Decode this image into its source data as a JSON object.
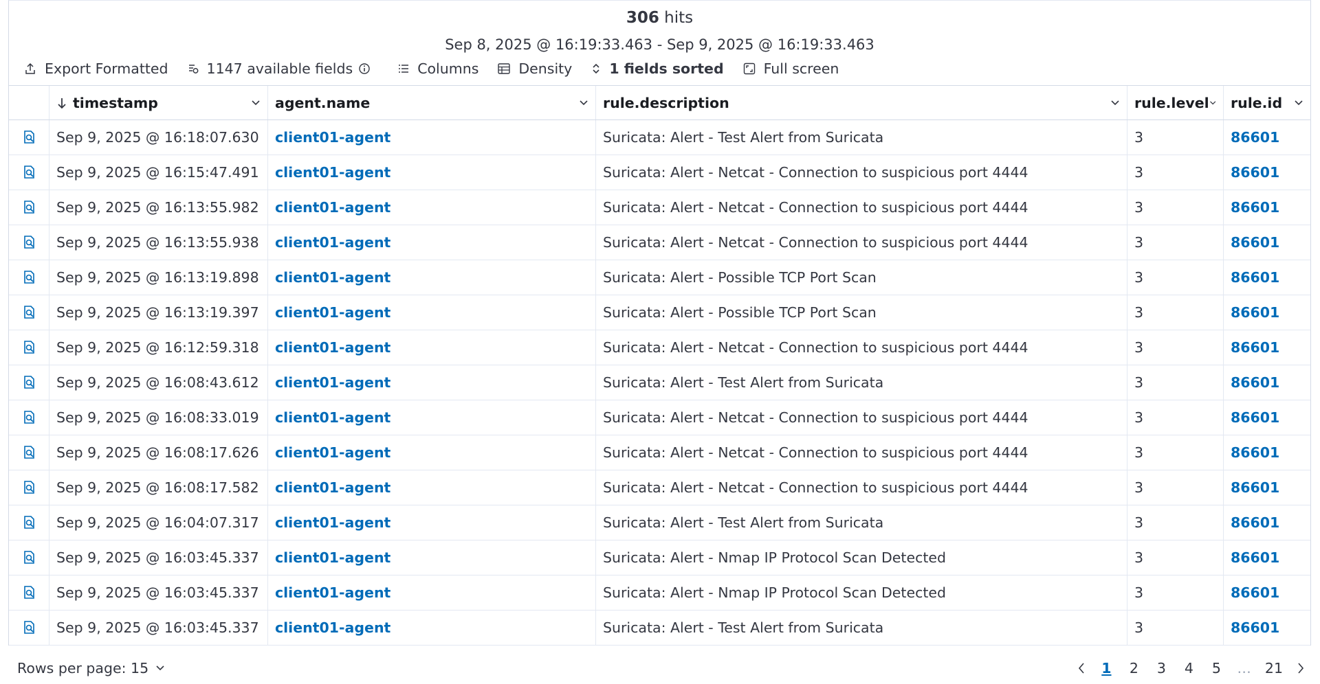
{
  "summary": {
    "hits_count": "306",
    "hits_label": "hits",
    "time_range": "Sep 8, 2025 @ 16:19:33.463 - Sep 9, 2025 @ 16:19:33.463"
  },
  "toolbar": {
    "export": "Export Formatted",
    "fields": "1147 available fields",
    "columns": "Columns",
    "density": "Density",
    "sorted": "1 fields sorted",
    "fullscreen": "Full screen"
  },
  "table": {
    "columns": [
      "timestamp",
      "agent.name",
      "rule.description",
      "rule.level",
      "rule.id"
    ],
    "rows": [
      {
        "timestamp": "Sep 9, 2025 @ 16:18:07.630",
        "agent": "client01-agent",
        "description": "Suricata: Alert - Test Alert from Suricata",
        "level": "3",
        "id": "86601"
      },
      {
        "timestamp": "Sep 9, 2025 @ 16:15:47.491",
        "agent": "client01-agent",
        "description": "Suricata: Alert - Netcat - Connection to suspicious port 4444",
        "level": "3",
        "id": "86601"
      },
      {
        "timestamp": "Sep 9, 2025 @ 16:13:55.982",
        "agent": "client01-agent",
        "description": "Suricata: Alert - Netcat - Connection to suspicious port 4444",
        "level": "3",
        "id": "86601"
      },
      {
        "timestamp": "Sep 9, 2025 @ 16:13:55.938",
        "agent": "client01-agent",
        "description": "Suricata: Alert - Netcat - Connection to suspicious port 4444",
        "level": "3",
        "id": "86601"
      },
      {
        "timestamp": "Sep 9, 2025 @ 16:13:19.898",
        "agent": "client01-agent",
        "description": "Suricata: Alert - Possible TCP Port Scan",
        "level": "3",
        "id": "86601"
      },
      {
        "timestamp": "Sep 9, 2025 @ 16:13:19.397",
        "agent": "client01-agent",
        "description": "Suricata: Alert - Possible TCP Port Scan",
        "level": "3",
        "id": "86601"
      },
      {
        "timestamp": "Sep 9, 2025 @ 16:12:59.318",
        "agent": "client01-agent",
        "description": "Suricata: Alert - Netcat - Connection to suspicious port 4444",
        "level": "3",
        "id": "86601"
      },
      {
        "timestamp": "Sep 9, 2025 @ 16:08:43.612",
        "agent": "client01-agent",
        "description": "Suricata: Alert - Test Alert from Suricata",
        "level": "3",
        "id": "86601"
      },
      {
        "timestamp": "Sep 9, 2025 @ 16:08:33.019",
        "agent": "client01-agent",
        "description": "Suricata: Alert - Netcat - Connection to suspicious port 4444",
        "level": "3",
        "id": "86601"
      },
      {
        "timestamp": "Sep 9, 2025 @ 16:08:17.626",
        "agent": "client01-agent",
        "description": "Suricata: Alert - Netcat - Connection to suspicious port 4444",
        "level": "3",
        "id": "86601"
      },
      {
        "timestamp": "Sep 9, 2025 @ 16:08:17.582",
        "agent": "client01-agent",
        "description": "Suricata: Alert - Netcat - Connection to suspicious port 4444",
        "level": "3",
        "id": "86601"
      },
      {
        "timestamp": "Sep 9, 2025 @ 16:04:07.317",
        "agent": "client01-agent",
        "description": "Suricata: Alert - Test Alert from Suricata",
        "level": "3",
        "id": "86601"
      },
      {
        "timestamp": "Sep 9, 2025 @ 16:03:45.337",
        "agent": "client01-agent",
        "description": "Suricata: Alert - Nmap IP Protocol Scan Detected",
        "level": "3",
        "id": "86601"
      },
      {
        "timestamp": "Sep 9, 2025 @ 16:03:45.337",
        "agent": "client01-agent",
        "description": "Suricata: Alert - Nmap IP Protocol Scan Detected",
        "level": "3",
        "id": "86601"
      },
      {
        "timestamp": "Sep 9, 2025 @ 16:03:45.337",
        "agent": "client01-agent",
        "description": "Suricata: Alert - Test Alert from Suricata",
        "level": "3",
        "id": "86601"
      }
    ]
  },
  "footer": {
    "rows_per_page": "Rows per page: 15",
    "pages": [
      "1",
      "2",
      "3",
      "4",
      "5",
      "…",
      "21"
    ],
    "active_page": "1"
  },
  "icons": {
    "inspect": "inspect-document-icon",
    "export": "export-icon",
    "fields": "fields-icon",
    "info": "info-icon",
    "columns": "columns-list-icon",
    "density": "density-table-icon",
    "sort": "sort-icon",
    "fullscreen": "fullscreen-icon",
    "sort_down": "arrow-down-icon",
    "chevron": "chevron-down-icon"
  },
  "colors": {
    "link": "#006bb8",
    "text": "#343741",
    "border": "#d3dae6"
  }
}
